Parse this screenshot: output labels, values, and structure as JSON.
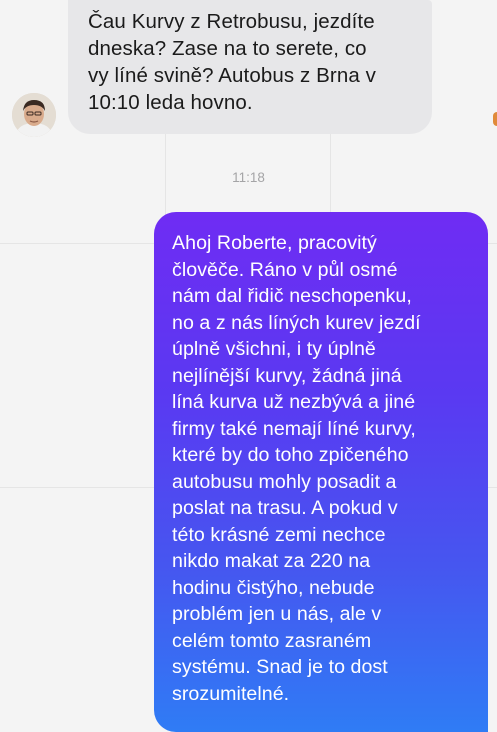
{
  "conversation": {
    "incoming_message": "Čau Kurvy z Retrobusu, jezdíte\ndneska? Zase na to serete, co\nvy líné svině? Autobus z Brna v\n10:10 leda hovno.",
    "timestamp": "11:18",
    "outgoing_message": "Ahoj Roberte, pracovitý\nčlověče. Ráno v půl osmé\nnám dal řidič neschopenku,\nno a z nás líných kurev jezdí\núplně všichni, i ty úplně\nnejlínější kurvy, žádná jiná\nlíná kurva už nezbývá a jiné\nfirmy také nemají líné kurvy,\nkteré by do toho zpičeného\nautobusu mohly posadit a\nposlat na trasu. A pokud v\ntéto krásné zemi nechce\nnikdo makat za 220 na\nhodinu čistýho, nebude\nproblém jen u nás, ale v\ncelém tomto zasraném\nsystému. Snad je to dost\nsrozumitelné."
  },
  "icons": {
    "avatar": "profile-photo",
    "edge_indicator": "orange-dot"
  },
  "colors": {
    "incoming_bubble": "#e7e7e9",
    "outgoing_gradient_top": "#6f2cf3",
    "outgoing_gradient_bottom": "#2f7cf5",
    "timestamp": "#a4a4a6",
    "background": "#f4f4f4"
  }
}
